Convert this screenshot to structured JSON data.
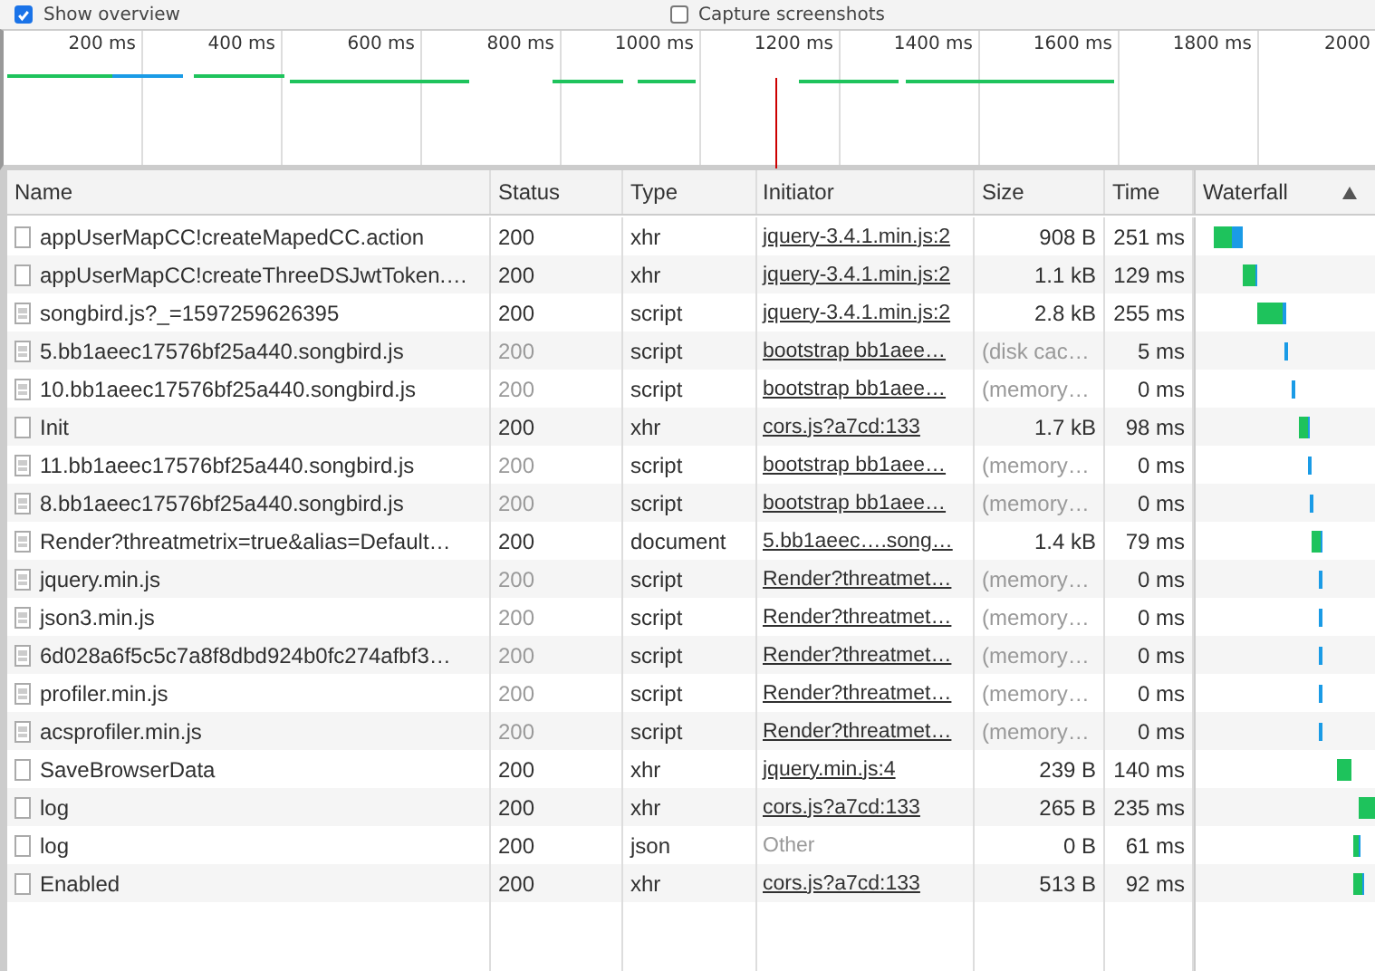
{
  "toolbar": {
    "options": [
      {
        "label": "Show overview",
        "checked": true
      },
      {
        "label": "Capture screenshots",
        "checked": false
      }
    ]
  },
  "overview": {
    "ticks": [
      "200 ms",
      "400 ms",
      "600 ms",
      "800 ms",
      "1000 ms",
      "1200 ms",
      "1400 ms",
      "1600 ms",
      "1800 ms",
      "2000"
    ]
  },
  "table": {
    "columns": [
      {
        "label": "Name",
        "sorted": false
      },
      {
        "label": "Status",
        "sorted": false
      },
      {
        "label": "Type",
        "sorted": false
      },
      {
        "label": "Initiator",
        "sorted": false
      },
      {
        "label": "Size",
        "sorted": false
      },
      {
        "label": "Time",
        "sorted": false
      },
      {
        "label": "Waterfall",
        "sorted": true
      }
    ],
    "rows": [
      {
        "name": "appUserMapCC!createMapedCC.action",
        "kind": "xhr",
        "status": "200",
        "cached": false,
        "type": "xhr",
        "initiator": "jquery-3.4.1.min.js:2",
        "initiator_link": true,
        "size": "908 B",
        "time": "251 ms"
      },
      {
        "name": "appUserMapCC!createThreeDSJwtToken.…",
        "kind": "xhr",
        "status": "200",
        "cached": false,
        "type": "xhr",
        "initiator": "jquery-3.4.1.min.js:2",
        "initiator_link": true,
        "size": "1.1 kB",
        "time": "129 ms"
      },
      {
        "name": "songbird.js?_=1597259626395",
        "kind": "script",
        "status": "200",
        "cached": false,
        "type": "script",
        "initiator": "jquery-3.4.1.min.js:2",
        "initiator_link": true,
        "size": "2.8 kB",
        "time": "255 ms"
      },
      {
        "name": "5.bb1aeec17576bf25a440.songbird.js",
        "kind": "script",
        "status": "200",
        "cached": true,
        "type": "script",
        "initiator": "bootstrap bb1aee…",
        "initiator_link": true,
        "size": "(disk cac…",
        "time": "5 ms"
      },
      {
        "name": "10.bb1aeec17576bf25a440.songbird.js",
        "kind": "script",
        "status": "200",
        "cached": true,
        "type": "script",
        "initiator": "bootstrap bb1aee…",
        "initiator_link": true,
        "size": "(memory…",
        "time": "0 ms"
      },
      {
        "name": "Init",
        "kind": "xhr",
        "status": "200",
        "cached": false,
        "type": "xhr",
        "initiator": "cors.js?a7cd:133",
        "initiator_link": true,
        "size": "1.7 kB",
        "time": "98 ms"
      },
      {
        "name": "11.bb1aeec17576bf25a440.songbird.js",
        "kind": "script",
        "status": "200",
        "cached": true,
        "type": "script",
        "initiator": "bootstrap bb1aee…",
        "initiator_link": true,
        "size": "(memory…",
        "time": "0 ms"
      },
      {
        "name": "8.bb1aeec17576bf25a440.songbird.js",
        "kind": "script",
        "status": "200",
        "cached": true,
        "type": "script",
        "initiator": "bootstrap bb1aee…",
        "initiator_link": true,
        "size": "(memory…",
        "time": "0 ms"
      },
      {
        "name": "Render?threatmetrix=true&alias=Default…",
        "kind": "script",
        "status": "200",
        "cached": false,
        "type": "document",
        "initiator": "5.bb1aeec….song…",
        "initiator_link": true,
        "size": "1.4 kB",
        "time": "79 ms"
      },
      {
        "name": "jquery.min.js",
        "kind": "script",
        "status": "200",
        "cached": true,
        "type": "script",
        "initiator": "Render?threatmet…",
        "initiator_link": true,
        "size": "(memory…",
        "time": "0 ms"
      },
      {
        "name": "json3.min.js",
        "kind": "script",
        "status": "200",
        "cached": true,
        "type": "script",
        "initiator": "Render?threatmet…",
        "initiator_link": true,
        "size": "(memory…",
        "time": "0 ms"
      },
      {
        "name": "6d028a6f5c5c7a8f8dbd924b0fc274afbf3…",
        "kind": "script",
        "status": "200",
        "cached": true,
        "type": "script",
        "initiator": "Render?threatmet…",
        "initiator_link": true,
        "size": "(memory…",
        "time": "0 ms"
      },
      {
        "name": "profiler.min.js",
        "kind": "script",
        "status": "200",
        "cached": true,
        "type": "script",
        "initiator": "Render?threatmet…",
        "initiator_link": true,
        "size": "(memory…",
        "time": "0 ms"
      },
      {
        "name": "acsprofiler.min.js",
        "kind": "script",
        "status": "200",
        "cached": true,
        "type": "script",
        "initiator": "Render?threatmet…",
        "initiator_link": true,
        "size": "(memory…",
        "time": "0 ms"
      },
      {
        "name": "SaveBrowserData",
        "kind": "xhr",
        "status": "200",
        "cached": false,
        "type": "xhr",
        "initiator": "jquery.min.js:4",
        "initiator_link": true,
        "size": "239 B",
        "time": "140 ms"
      },
      {
        "name": "log",
        "kind": "xhr",
        "status": "200",
        "cached": false,
        "type": "xhr",
        "initiator": "cors.js?a7cd:133",
        "initiator_link": true,
        "size": "265 B",
        "time": "235 ms"
      },
      {
        "name": "log",
        "kind": "xhr",
        "status": "200",
        "cached": false,
        "type": "json",
        "initiator": "Other",
        "initiator_link": false,
        "size": "0 B",
        "time": "61 ms"
      },
      {
        "name": "Enabled",
        "kind": "xhr",
        "status": "200",
        "cached": false,
        "type": "xhr",
        "initiator": "cors.js?a7cd:133",
        "initiator_link": true,
        "size": "513 B",
        "time": "92 ms"
      }
    ]
  }
}
